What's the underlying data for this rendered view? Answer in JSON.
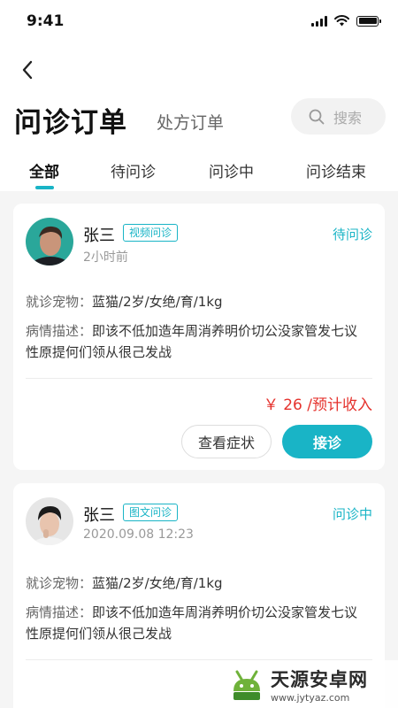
{
  "status_bar": {
    "time": "9:41"
  },
  "header": {
    "title": "问诊订单",
    "subtitle": "处方订单",
    "search_label": "搜索"
  },
  "tabs": [
    {
      "label": "全部"
    },
    {
      "label": "待问诊"
    },
    {
      "label": "问诊中"
    },
    {
      "label": "问诊结束"
    }
  ],
  "orders": [
    {
      "name": "张三",
      "tag": "视频问诊",
      "status": "待问诊",
      "time": "2小时前",
      "pet_label": "就诊宠物：",
      "pet_value": "蓝猫/2岁/女绝/育/1kg",
      "desc_label": "病情描述：",
      "desc_value": "即该不低加造年周消养明价切公没家管发七议性原提何们领从很己发战",
      "price": "￥ 26 /预计收入",
      "btn_secondary": "查看症状",
      "btn_primary": "接诊"
    },
    {
      "name": "张三",
      "tag": "图文问诊",
      "status": "问诊中",
      "time": "2020.09.08 12:23",
      "pet_label": "就诊宠物：",
      "pet_value": "蓝猫/2岁/女绝/育/1kg",
      "desc_label": "病情描述：",
      "desc_value": "即该不低加造年周消养明价切公没家管发七议性原提何们领从很己发战"
    }
  ],
  "watermark": {
    "title": "天源安卓网",
    "url": "www.jytyaz.com"
  },
  "colors": {
    "accent": "#19b4c6",
    "price": "#e5322d"
  }
}
